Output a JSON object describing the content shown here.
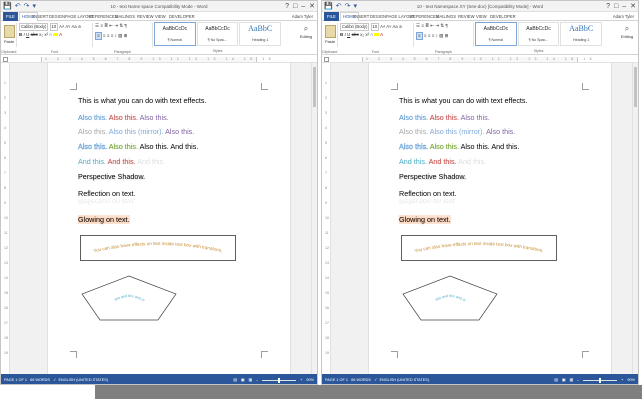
{
  "windows": [
    {
      "title": "10 - text Name space Compatibility Mode - Word",
      "qat": {
        "save": "💾",
        "undo": "↶",
        "redo": "↷",
        "more": "▾"
      },
      "controls": {
        "help": "?",
        "restore": "□",
        "minimize": "–",
        "close": "✕"
      },
      "user": "Adam Tyler",
      "tabs": [
        "FILE",
        "HOME",
        "INSERT",
        "DESIGN",
        "PAGE LAYOUT",
        "REFERENCES",
        "MAILINGS",
        "REVIEW",
        "VIEW",
        "DEVELOPER"
      ],
      "font": {
        "name": "Calibri (Body)",
        "size": "10",
        "grow": "A˄",
        "shrink": "A˅",
        "case": "Aa",
        "clear": "⊘"
      },
      "format": {
        "bold": "B",
        "italic": "I",
        "underline": "U",
        "strike": "abc",
        "sub": "x₂",
        "sup": "x²",
        "effects": "A",
        "color": "A"
      },
      "para": {
        "bullets": "☰",
        "numbers": "≡",
        "multilevel": "≣",
        "decrease": "⇤",
        "increase": "⇥",
        "sort": "⇅",
        "marks": "¶"
      },
      "para2": {
        "left": "≡",
        "center": "≡",
        "right": "≡",
        "justify": "≡",
        "spacing": "↕",
        "shading": "▨",
        "borders": "⊞"
      },
      "groups": {
        "clipboard": "Clipboard",
        "font": "Font",
        "paragraph": "Paragraph",
        "styles": "Styles"
      },
      "paste": "Paste",
      "styles": [
        {
          "preview": "AaBbCcDc",
          "name": "¶ Normal"
        },
        {
          "preview": "AaBbCcDc",
          "name": "¶ No Spac..."
        },
        {
          "preview": "AaBbC",
          "name": "Heading 1"
        }
      ],
      "editing": "Editing",
      "ruler_numbers": "1 2 3 4 5 6 7 8 9 10 11 12 13 14 15 16",
      "vruler": [
        "1",
        "2",
        "3",
        "4",
        "5",
        "6",
        "7",
        "8",
        "9",
        "10",
        "11",
        "12",
        "13",
        "14",
        "15",
        "16",
        "17",
        "18",
        "19"
      ],
      "doc": {
        "l1": "This is what you can do with text effects.",
        "l2": [
          "Also this.",
          "Also this.",
          "Also this."
        ],
        "l3": [
          "Also this.",
          "Also this (mirror).",
          "Also this."
        ],
        "l4": [
          "Also this.",
          "Also this.",
          "Also this.",
          "And this."
        ],
        "l5": [
          "And this.",
          "And this.",
          "And this."
        ],
        "l6": "Perspective Shadow.",
        "l7": "Reflection on text.",
        "l8": "Glowing on text.",
        "arc": "You can also have effects on text inside text box with transform.",
        "penta": "Like this and this and more."
      },
      "status": {
        "page": "PAGE 1 OF 1",
        "words": "66 WORDS",
        "lang": "ENGLISH (UNITED STATES)",
        "zoom": "90%"
      },
      "zoom_fraction": 0.5
    },
    {
      "title": "10 - text Namespace.XY (See-doc) [Compatibility Mode] - Word",
      "qat": {
        "save": "💾",
        "undo": "↶",
        "redo": "↷",
        "more": "▾"
      },
      "controls": {
        "help": "?",
        "restore": "□",
        "minimize": "–",
        "close": "✕"
      },
      "user": "Adam Tyler",
      "tabs": [
        "FILE",
        "HOME",
        "INSERT",
        "DESIGN",
        "PAGE LAYOUT",
        "REFERENCES",
        "MAILINGS",
        "REVIEW",
        "VIEW",
        "DEVELOPER"
      ],
      "font": {
        "name": "Calibri (Body)",
        "size": "10",
        "grow": "A˄",
        "shrink": "A˅",
        "case": "Aa",
        "clear": "⊘"
      },
      "format": {
        "bold": "B",
        "italic": "I",
        "underline": "U",
        "strike": "abc",
        "sub": "x₂",
        "sup": "x²",
        "effects": "A",
        "color": "A"
      },
      "para": {
        "bullets": "☰",
        "numbers": "≡",
        "multilevel": "≣",
        "decrease": "⇤",
        "increase": "⇥",
        "sort": "⇅",
        "marks": "¶"
      },
      "para2": {
        "left": "≡",
        "center": "≡",
        "right": "≡",
        "justify": "≡",
        "spacing": "↕",
        "shading": "▨",
        "borders": "⊞"
      },
      "groups": {
        "clipboard": "Clipboard",
        "font": "Font",
        "paragraph": "Paragraph",
        "styles": "Styles"
      },
      "paste": "Paste",
      "styles": [
        {
          "preview": "AaBbCcDc",
          "name": "¶ Normal"
        },
        {
          "preview": "AaBbCcDc",
          "name": "¶ No Spac..."
        },
        {
          "preview": "AaBbC",
          "name": "Heading 1"
        }
      ],
      "editing": "Editing",
      "ruler_numbers": "1 2 3 4 5 6 7 8 9 10 11 12 13 14 15 16",
      "vruler": [
        "1",
        "2",
        "3",
        "4",
        "5",
        "6",
        "7",
        "8",
        "9",
        "10",
        "11",
        "12",
        "13",
        "14",
        "15",
        "16",
        "17",
        "18",
        "19"
      ],
      "doc": {
        "l1": "This is what you can do with text effects.",
        "l2": [
          "Also this.",
          "Also this.",
          "Also this."
        ],
        "l3": [
          "Also this.",
          "Also this (mirror).",
          "Also this."
        ],
        "l4": [
          "Also this.",
          "Also this.",
          "Also this.",
          "And this."
        ],
        "l5": [
          "And this.",
          "And this.",
          "And this."
        ],
        "l6": "Perspective Shadow.",
        "l7": "Reflection on text.",
        "l8": "Glowing on text.",
        "arc": "You can also have effects on text inside text box with transform.",
        "penta": "Like this and this and more."
      },
      "status": {
        "page": "PAGE 1 OF 1",
        "words": "66 WORDS",
        "lang": "ENGLISH (UNITED STATES)",
        "zoom": "90%"
      },
      "zoom_fraction": 0.5
    }
  ],
  "colors": {
    "accent": "#2b579a",
    "text_blue": "#5b9bd5",
    "text_red": "#c0504d",
    "text_purple": "#8064a2",
    "text_green": "#6b9e2c",
    "glow": "#f4b183"
  }
}
